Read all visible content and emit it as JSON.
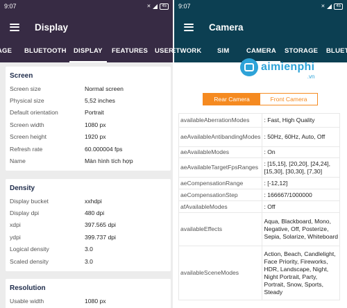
{
  "left": {
    "status": {
      "time": "9:07",
      "battery": "45"
    },
    "title": "Display",
    "tabs": [
      "AGE",
      "BLUETOOTH",
      "DISPLAY",
      "FEATURES",
      "USER"
    ],
    "active_tab": "DISPLAY",
    "sections": [
      {
        "title": "Screen",
        "rows": [
          {
            "k": "Screen size",
            "v": "Normal screen"
          },
          {
            "k": "Physical size",
            "v": "5,52 inches"
          },
          {
            "k": "Default orientation",
            "v": "Portrait"
          },
          {
            "k": "Screen width",
            "v": "1080 px"
          },
          {
            "k": "Screen height",
            "v": "1920 px"
          },
          {
            "k": "Refresh rate",
            "v": "60.000004 fps"
          },
          {
            "k": "Name",
            "v": "Màn hình tích hợp"
          }
        ]
      },
      {
        "title": "Density",
        "rows": [
          {
            "k": "Display bucket",
            "v": "xxhdpi"
          },
          {
            "k": "Display dpi",
            "v": "480 dpi"
          },
          {
            "k": "xdpi",
            "v": "397.565 dpi"
          },
          {
            "k": "ydpi",
            "v": "399.737 dpi"
          },
          {
            "k": "Logical density",
            "v": "3.0"
          },
          {
            "k": "Scaled density",
            "v": "3.0"
          }
        ]
      },
      {
        "title": "Resolution",
        "rows": [
          {
            "k": "Usable width",
            "v": "1080 px"
          }
        ]
      }
    ]
  },
  "right": {
    "status": {
      "time": "9:07",
      "battery": "45"
    },
    "title": "Camera",
    "tabs": [
      "ETWORK",
      "SIM",
      "CAMERA",
      "STORAGE",
      "BLUETO"
    ],
    "active_tab": "CAMERA",
    "watermark": {
      "text": "aimienphi",
      "suffix": ".vn"
    },
    "segments": [
      "Rear Camera",
      "Front Camera"
    ],
    "rows": [
      {
        "k": "availableAberrationModes",
        "v": ": Fast, High Quality"
      },
      {
        "k": "aeAvailableAntibandingModes",
        "v": ": 50Hz, 60Hz, Auto, Off"
      },
      {
        "k": "aeAvailableModes",
        "v": ": On"
      },
      {
        "k": "aeAvailableTargetFpsRanges",
        "v": ": [15,15], [20,20], [24,24], [15,30], [30,30], [7,30]"
      },
      {
        "k": "aeCompensationRange",
        "v": ": [-12,12]"
      },
      {
        "k": "aeCompensationStep",
        "v": ": 166667/1000000"
      },
      {
        "k": "afAvailableModes",
        "v": ": Off"
      },
      {
        "k": "availableEffects",
        "v": "Aqua, Blackboard, Mono, Negative, Off, Posterize, Sepia, Solarize, Whiteboard"
      },
      {
        "k": "availableSceneModes",
        "v": "Action, Beach, Candlelight, Face Priority, Fireworks, HDR, Landscape, Night, Night Portrait, Party, Portrait, Snow, Sports, Steady"
      }
    ]
  }
}
